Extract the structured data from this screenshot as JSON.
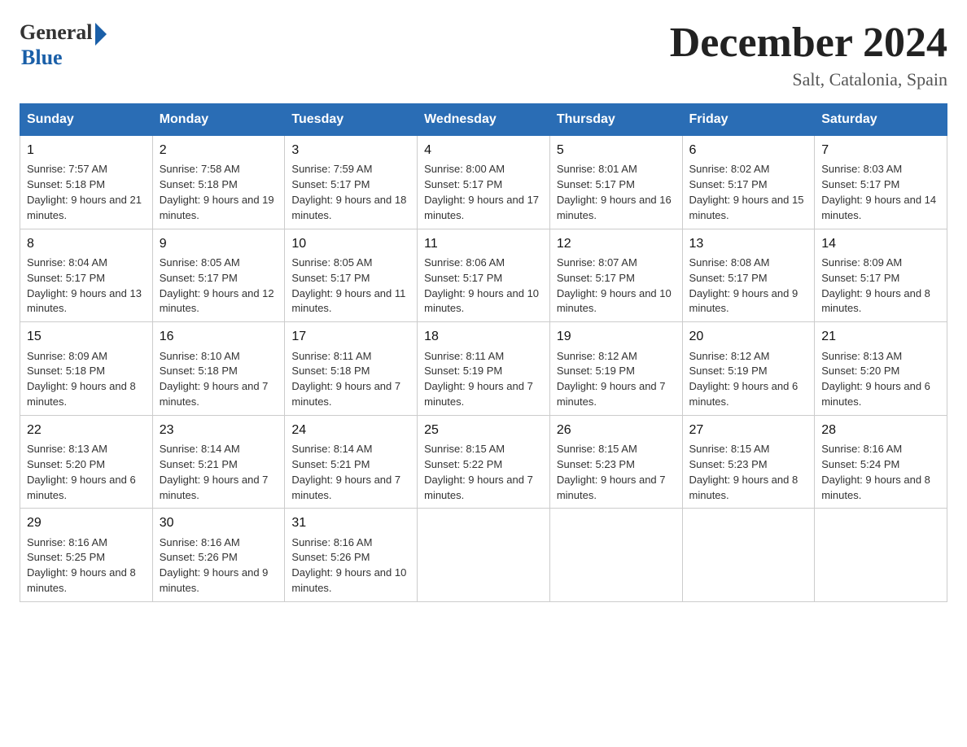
{
  "logo": {
    "general": "General",
    "blue": "Blue"
  },
  "title": {
    "month_year": "December 2024",
    "location": "Salt, Catalonia, Spain"
  },
  "weekdays": [
    "Sunday",
    "Monday",
    "Tuesday",
    "Wednesday",
    "Thursday",
    "Friday",
    "Saturday"
  ],
  "weeks": [
    [
      {
        "day": "1",
        "sunrise": "7:57 AM",
        "sunset": "5:18 PM",
        "daylight": "9 hours and 21 minutes."
      },
      {
        "day": "2",
        "sunrise": "7:58 AM",
        "sunset": "5:18 PM",
        "daylight": "9 hours and 19 minutes."
      },
      {
        "day": "3",
        "sunrise": "7:59 AM",
        "sunset": "5:17 PM",
        "daylight": "9 hours and 18 minutes."
      },
      {
        "day": "4",
        "sunrise": "8:00 AM",
        "sunset": "5:17 PM",
        "daylight": "9 hours and 17 minutes."
      },
      {
        "day": "5",
        "sunrise": "8:01 AM",
        "sunset": "5:17 PM",
        "daylight": "9 hours and 16 minutes."
      },
      {
        "day": "6",
        "sunrise": "8:02 AM",
        "sunset": "5:17 PM",
        "daylight": "9 hours and 15 minutes."
      },
      {
        "day": "7",
        "sunrise": "8:03 AM",
        "sunset": "5:17 PM",
        "daylight": "9 hours and 14 minutes."
      }
    ],
    [
      {
        "day": "8",
        "sunrise": "8:04 AM",
        "sunset": "5:17 PM",
        "daylight": "9 hours and 13 minutes."
      },
      {
        "day": "9",
        "sunrise": "8:05 AM",
        "sunset": "5:17 PM",
        "daylight": "9 hours and 12 minutes."
      },
      {
        "day": "10",
        "sunrise": "8:05 AM",
        "sunset": "5:17 PM",
        "daylight": "9 hours and 11 minutes."
      },
      {
        "day": "11",
        "sunrise": "8:06 AM",
        "sunset": "5:17 PM",
        "daylight": "9 hours and 10 minutes."
      },
      {
        "day": "12",
        "sunrise": "8:07 AM",
        "sunset": "5:17 PM",
        "daylight": "9 hours and 10 minutes."
      },
      {
        "day": "13",
        "sunrise": "8:08 AM",
        "sunset": "5:17 PM",
        "daylight": "9 hours and 9 minutes."
      },
      {
        "day": "14",
        "sunrise": "8:09 AM",
        "sunset": "5:17 PM",
        "daylight": "9 hours and 8 minutes."
      }
    ],
    [
      {
        "day": "15",
        "sunrise": "8:09 AM",
        "sunset": "5:18 PM",
        "daylight": "9 hours and 8 minutes."
      },
      {
        "day": "16",
        "sunrise": "8:10 AM",
        "sunset": "5:18 PM",
        "daylight": "9 hours and 7 minutes."
      },
      {
        "day": "17",
        "sunrise": "8:11 AM",
        "sunset": "5:18 PM",
        "daylight": "9 hours and 7 minutes."
      },
      {
        "day": "18",
        "sunrise": "8:11 AM",
        "sunset": "5:19 PM",
        "daylight": "9 hours and 7 minutes."
      },
      {
        "day": "19",
        "sunrise": "8:12 AM",
        "sunset": "5:19 PM",
        "daylight": "9 hours and 7 minutes."
      },
      {
        "day": "20",
        "sunrise": "8:12 AM",
        "sunset": "5:19 PM",
        "daylight": "9 hours and 6 minutes."
      },
      {
        "day": "21",
        "sunrise": "8:13 AM",
        "sunset": "5:20 PM",
        "daylight": "9 hours and 6 minutes."
      }
    ],
    [
      {
        "day": "22",
        "sunrise": "8:13 AM",
        "sunset": "5:20 PM",
        "daylight": "9 hours and 6 minutes."
      },
      {
        "day": "23",
        "sunrise": "8:14 AM",
        "sunset": "5:21 PM",
        "daylight": "9 hours and 7 minutes."
      },
      {
        "day": "24",
        "sunrise": "8:14 AM",
        "sunset": "5:21 PM",
        "daylight": "9 hours and 7 minutes."
      },
      {
        "day": "25",
        "sunrise": "8:15 AM",
        "sunset": "5:22 PM",
        "daylight": "9 hours and 7 minutes."
      },
      {
        "day": "26",
        "sunrise": "8:15 AM",
        "sunset": "5:23 PM",
        "daylight": "9 hours and 7 minutes."
      },
      {
        "day": "27",
        "sunrise": "8:15 AM",
        "sunset": "5:23 PM",
        "daylight": "9 hours and 8 minutes."
      },
      {
        "day": "28",
        "sunrise": "8:16 AM",
        "sunset": "5:24 PM",
        "daylight": "9 hours and 8 minutes."
      }
    ],
    [
      {
        "day": "29",
        "sunrise": "8:16 AM",
        "sunset": "5:25 PM",
        "daylight": "9 hours and 8 minutes."
      },
      {
        "day": "30",
        "sunrise": "8:16 AM",
        "sunset": "5:26 PM",
        "daylight": "9 hours and 9 minutes."
      },
      {
        "day": "31",
        "sunrise": "8:16 AM",
        "sunset": "5:26 PM",
        "daylight": "9 hours and 10 minutes."
      },
      null,
      null,
      null,
      null
    ]
  ]
}
